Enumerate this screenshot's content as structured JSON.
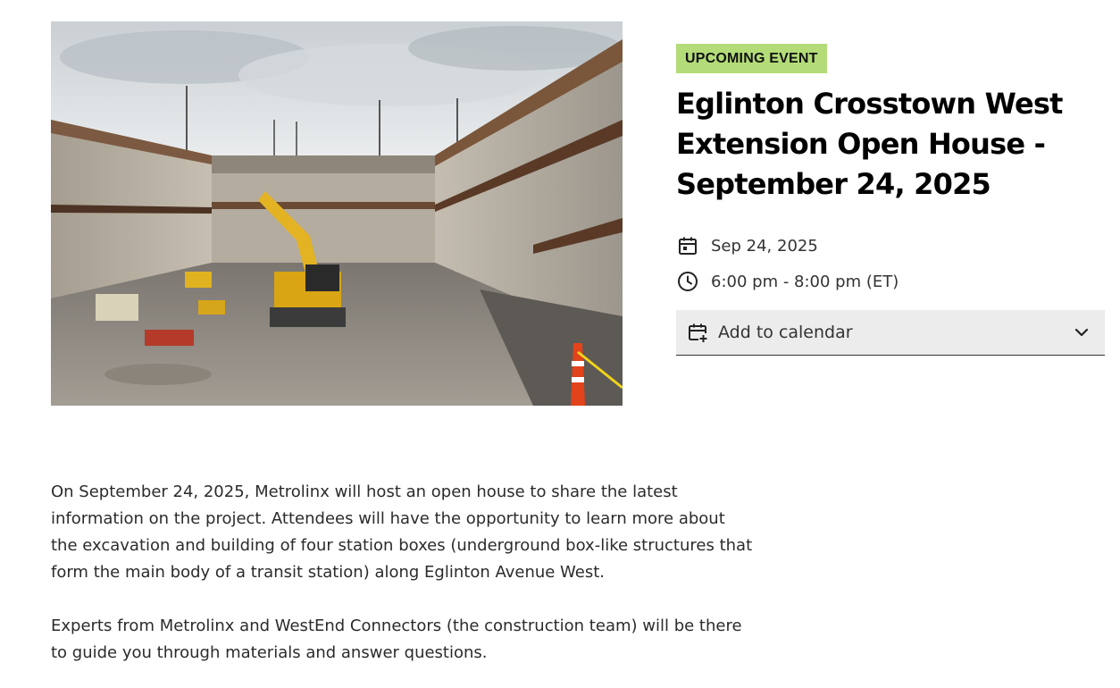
{
  "hero": {
    "image_alt": "Construction site excavation for a station box with an excavator"
  },
  "event": {
    "badge": "UPCOMING EVENT",
    "title": "Eglinton Crosstown West Extension Open House - September 24, 2025",
    "date": "Sep 24, 2025",
    "time": "6:00 pm - 8:00 pm (ET)",
    "add_to_calendar": "Add to calendar"
  },
  "description": {
    "paragraph1": "On September 24, 2025, Metrolinx will host an open house to share the latest information on the project. Attendees will have the opportunity to learn more about the excavation and building of four station boxes (underground box-like structures that form the main body of a transit station) along Eglinton Avenue West.",
    "paragraph2": "Experts from Metrolinx and WestEnd Connectors (the construction team) will be there to guide you through materials and answer questions."
  },
  "colors": {
    "badge_bg": "#b3dc78",
    "dropdown_bg": "#ececec",
    "text": "#2b2b2b"
  },
  "icons": {
    "date": "calendar-icon",
    "time": "clock-icon",
    "add_calendar": "calendar-add-icon",
    "dropdown": "chevron-down-icon"
  }
}
